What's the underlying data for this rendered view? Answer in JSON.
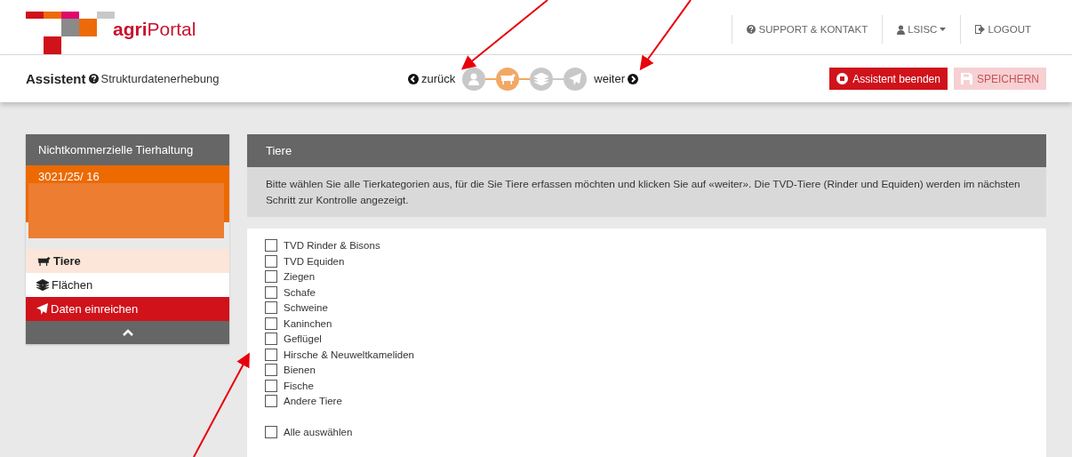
{
  "brand": {
    "name_bold": "agri",
    "name_rest": "Portal"
  },
  "top_nav": [
    {
      "kind": "help",
      "label": "SUPPORT & KONTAKT"
    },
    {
      "kind": "user",
      "label": "LSISC"
    },
    {
      "kind": "logout",
      "label": "LOGOUT"
    }
  ],
  "assistant": {
    "title": "Assistent",
    "subtitle": "Strukturdatenerhebung",
    "back": "zurück",
    "next": "weiter",
    "steps": [
      {
        "kind": "user",
        "selected": false
      },
      {
        "kind": "cow",
        "selected": true
      },
      {
        "kind": "layers",
        "selected": false
      },
      {
        "kind": "send",
        "selected": false
      }
    ],
    "buttons": [
      {
        "kind": "stop",
        "label": "Assistent beenden",
        "disabled": false
      },
      {
        "kind": "save",
        "label": "SPEICHERN",
        "disabled": true
      }
    ]
  },
  "sidebar": {
    "title": "Nichtkommerzielle Tierhaltung",
    "number": "3021/25/ 16",
    "items": [
      {
        "kind": "cow",
        "label": "Tiere",
        "selected": true
      },
      {
        "kind": "layers",
        "label": "Flächen",
        "selected": false
      },
      {
        "kind": "send",
        "label": "Daten einreichen",
        "selected": false
      }
    ]
  },
  "panel": {
    "title": "Tiere",
    "info": "Bitte wählen Sie alle Tierkategorien aus, für die Sie Tiere erfassen möchten und klicken Sie auf «weiter». Die TVD-Tiere (Rinder und Equiden) werden im nächsten Schritt zur Kontrolle angezeigt.",
    "options": [
      {
        "label": "TVD Rinder & Bisons",
        "checked": false
      },
      {
        "label": "TVD Equiden",
        "checked": false
      },
      {
        "label": "Ziegen",
        "checked": false
      },
      {
        "label": "Schafe",
        "checked": false
      },
      {
        "label": "Schweine",
        "checked": false
      },
      {
        "label": "Kaninchen",
        "checked": false
      },
      {
        "label": "Geflügel",
        "checked": false
      },
      {
        "label": "Hirsche & Neuweltkameliden",
        "checked": false
      },
      {
        "label": "Bienen",
        "checked": false
      },
      {
        "label": "Fische",
        "checked": false
      },
      {
        "label": "Andere Tiere",
        "checked": false
      }
    ],
    "select_all": {
      "label": "Alle auswählen",
      "checked": false
    }
  }
}
